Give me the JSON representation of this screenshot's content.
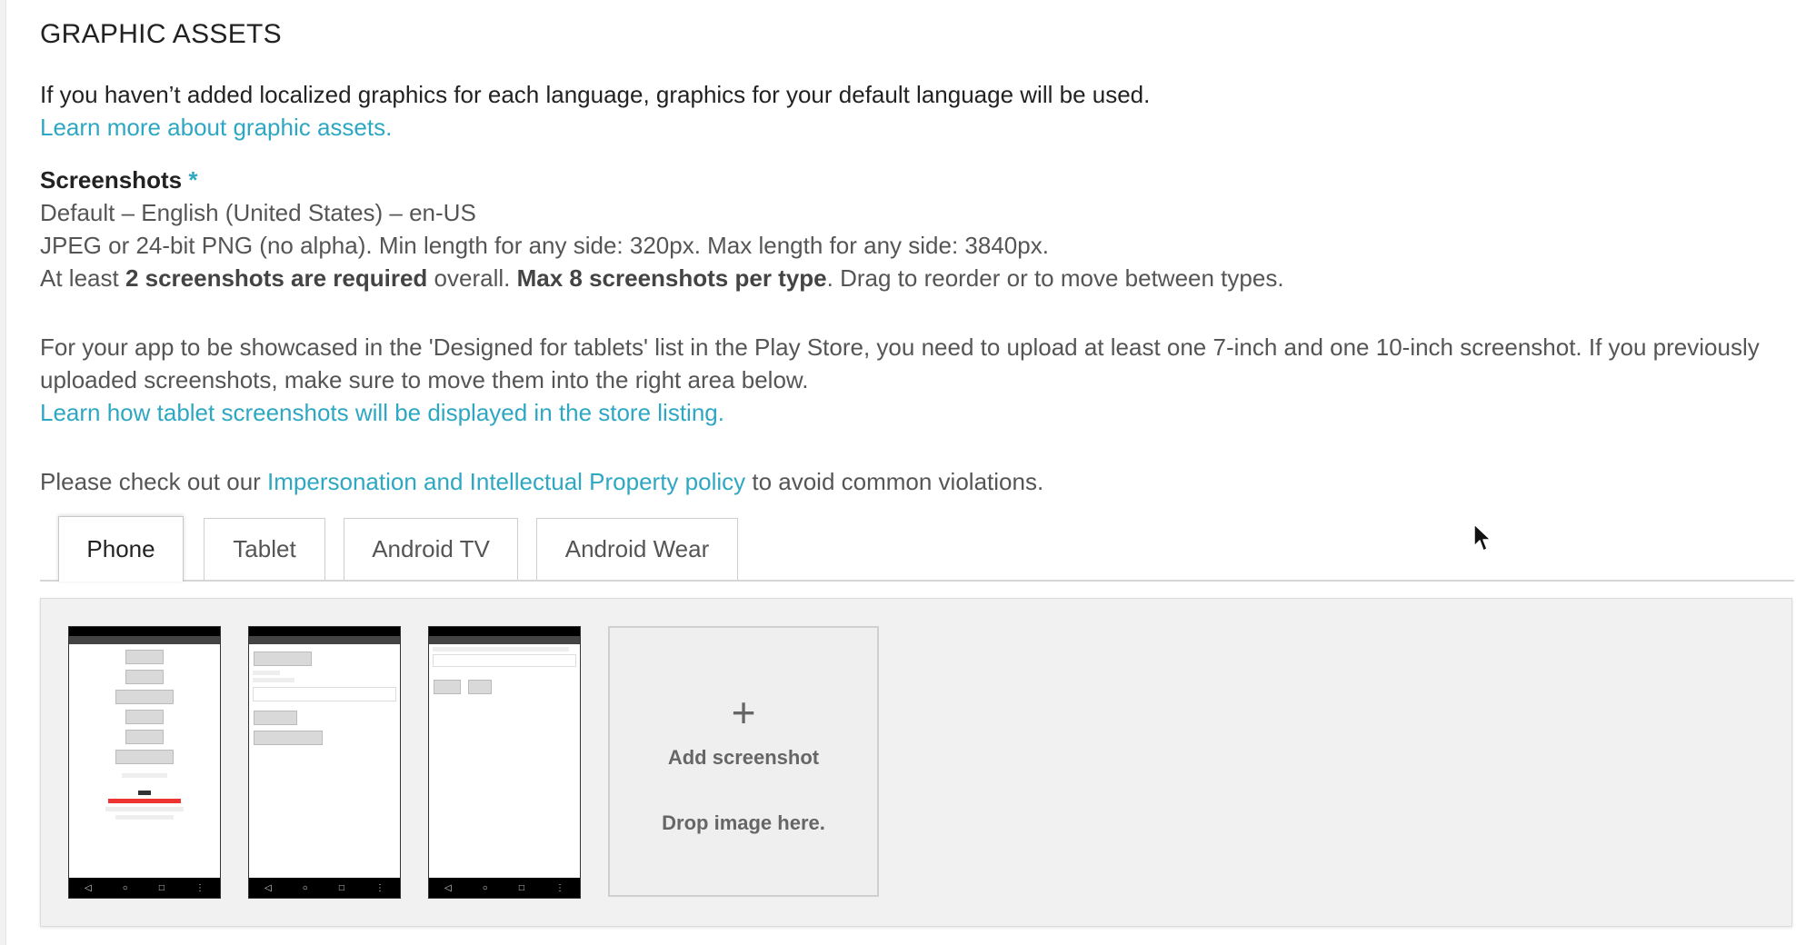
{
  "section": {
    "title": "GRAPHIC ASSETS",
    "intro": "If you haven’t added localized graphics for each language, graphics for your default language will be used.",
    "learn_more_link": "Learn more about graphic assets."
  },
  "screenshots": {
    "heading": "Screenshots",
    "required_marker": "*",
    "language_line": "Default – English (United States) – en-US",
    "format_line": "JPEG or 24-bit PNG (no alpha). Min length for any side: 320px. Max length for any side: 3840px.",
    "rules": {
      "prefix": "At least ",
      "required_bold": "2 screenshots are required",
      "middle": " overall. ",
      "max_bold": "Max 8 screenshots per type",
      "suffix": ". Drag to reorder or to move between types."
    },
    "tablet_note_line1": "For your app to be showcased in the 'Designed for tablets' list in the Play Store, you need to upload at least one 7-inch and one 10-inch screenshot. If you previously",
    "tablet_note_line2": "uploaded screenshots, make sure to move them into the right area below.",
    "tablet_link": "Learn how tablet screenshots will be displayed in the store listing.",
    "policy": {
      "prefix": "Please check out our ",
      "link": "Impersonation and Intellectual Property policy",
      "suffix": " to avoid common violations."
    }
  },
  "tabs": [
    {
      "label": "Phone",
      "active": true
    },
    {
      "label": "Tablet",
      "active": false
    },
    {
      "label": "Android TV",
      "active": false
    },
    {
      "label": "Android Wear",
      "active": false
    }
  ],
  "upload": {
    "plus": "+",
    "add_label": "Add screenshot",
    "drop_label": "Drop image here."
  },
  "colors": {
    "link": "#2ea7c3",
    "panel_bg": "#f1f1f1",
    "text": "#555555"
  }
}
